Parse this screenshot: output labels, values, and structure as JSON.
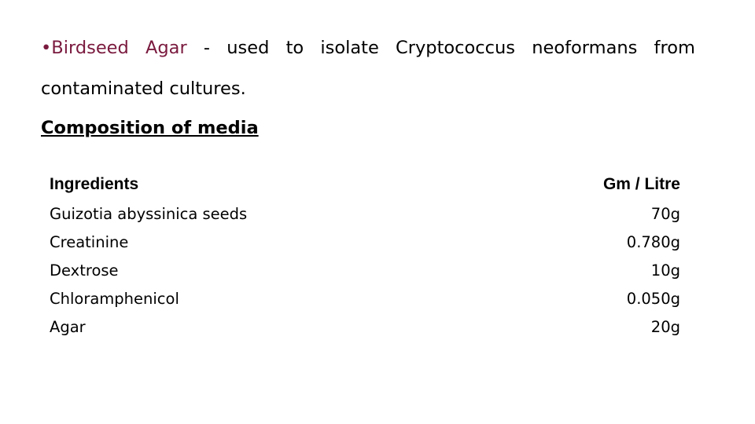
{
  "intro": {
    "bullet": "•",
    "term_words": [
      "Birdseed",
      "Agar"
    ],
    "rest_words": [
      "-",
      "used",
      "to",
      "isolate",
      "Cryptococcus",
      "neoformans",
      "from"
    ],
    "continuation": "contaminated cultures."
  },
  "section_title": "Composition of media",
  "table": {
    "headers": [
      "Ingredients",
      "Gm / Litre"
    ],
    "rows": [
      [
        "Guizotia abyssinica seeds",
        "70g"
      ],
      [
        "Creatinine",
        "0.780g"
      ],
      [
        "Dextrose",
        "10g"
      ],
      [
        "Chloramphenicol",
        "0.050g"
      ],
      [
        "Agar",
        "20g"
      ]
    ]
  },
  "colors": {
    "accent": "#7a1a3e"
  }
}
